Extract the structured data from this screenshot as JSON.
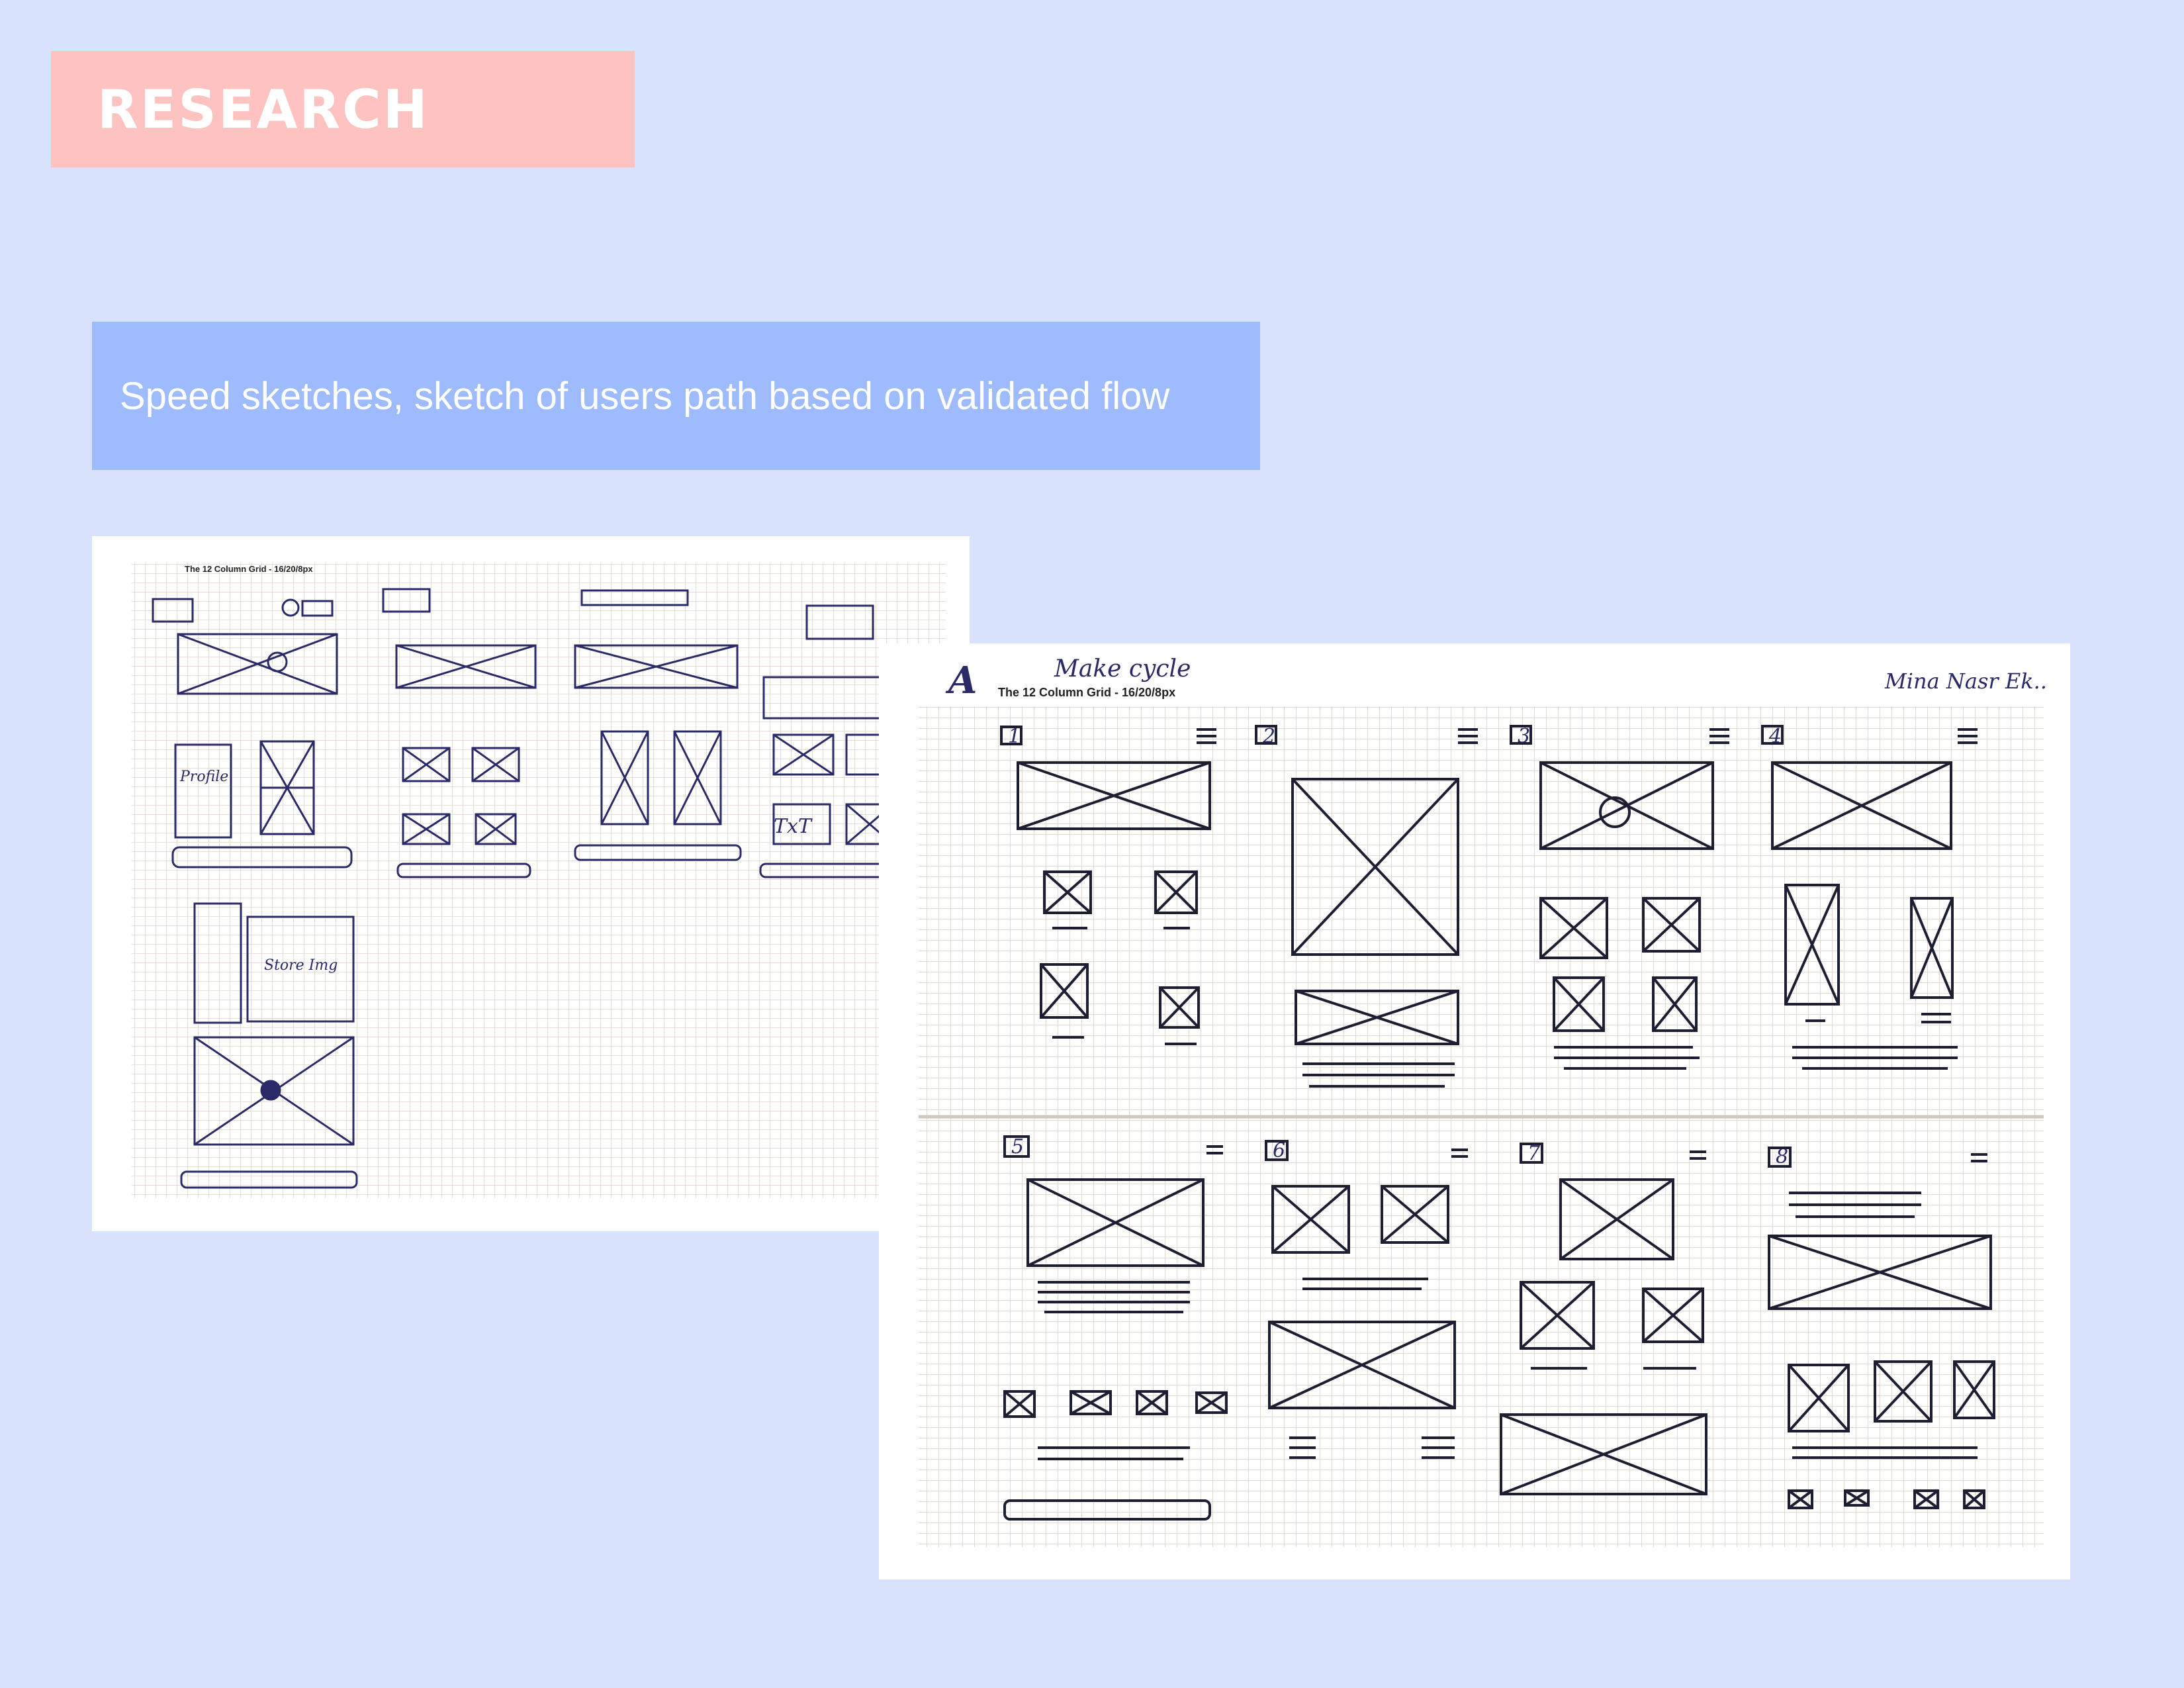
{
  "section_badge": {
    "label": "RESEARCH",
    "color": "#fec3c1"
  },
  "caption": {
    "text": "Speed sketches, sketch of users path based on validated flow",
    "color": "#9ebcfd"
  },
  "sketch_left": {
    "grid_title": "The 12 Column Grid - 16/20/8px",
    "notes": [
      "Profile",
      "Store Img",
      "TxT"
    ]
  },
  "sketch_right": {
    "corner_mark": "A",
    "heading_note": "Make cycle",
    "grid_title": "The 12 Column Grid - 16/20/8px",
    "author_note": "Mina Nasr Ek..",
    "step_marks": [
      "1",
      "2",
      "3",
      "4",
      "5",
      "6",
      "7",
      "8"
    ]
  }
}
